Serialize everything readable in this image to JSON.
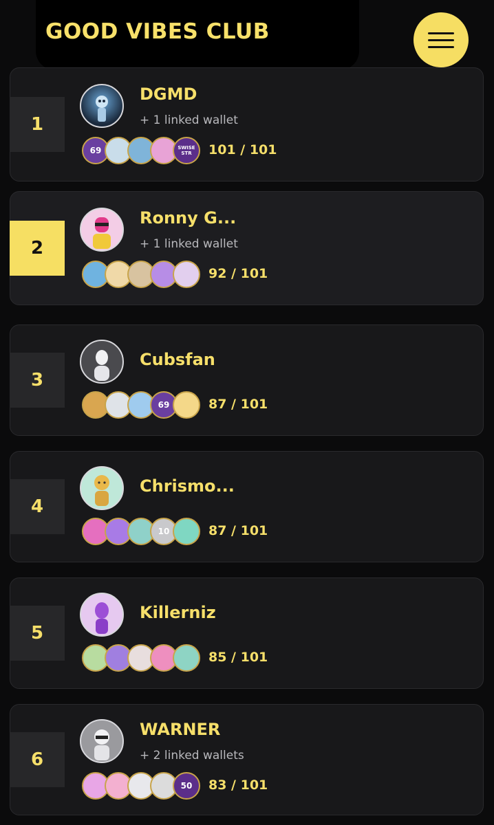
{
  "header": {
    "title": "GOOD VIBES CLUB",
    "menu_icon": "hamburger-menu-icon"
  },
  "colors": {
    "accent": "#f6df63",
    "card_bg": "#18181a",
    "rank_bg": "#272729",
    "page_bg": "#0b0b0c"
  },
  "leaderboard": [
    {
      "rank": "1",
      "name": "DGMD",
      "linked": "+ 1 linked wallet",
      "score": "101 / 101",
      "badges": [
        {
          "label": "69",
          "color": "#6a3fa0"
        },
        {
          "label": "",
          "color": "#c9ddea"
        },
        {
          "label": "",
          "color": "#7fb4d9"
        },
        {
          "label": "",
          "color": "#e8a3d6"
        },
        {
          "label": "SWISE STR",
          "color": "#5b2e8a"
        }
      ]
    },
    {
      "rank": "2",
      "name": "Ronny G...",
      "linked": "+ 1 linked wallet",
      "score": "92 / 101",
      "badges": [
        {
          "label": "",
          "color": "#6fb3e0"
        },
        {
          "label": "",
          "color": "#f0d9a8"
        },
        {
          "label": "",
          "color": "#d8c3a0"
        },
        {
          "label": "",
          "color": "#b78de6"
        },
        {
          "label": "",
          "color": "#e2cfee"
        }
      ]
    },
    {
      "rank": "3",
      "name": "Cubsfan",
      "linked": "",
      "score": "87 / 101",
      "badges": [
        {
          "label": "",
          "color": "#d9a650"
        },
        {
          "label": "",
          "color": "#dfe3e8"
        },
        {
          "label": "",
          "color": "#9fcbee"
        },
        {
          "label": "69",
          "color": "#6a3fa0"
        },
        {
          "label": "",
          "color": "#f4d889"
        }
      ]
    },
    {
      "rank": "4",
      "name": "Chrismo...",
      "linked": "",
      "score": "87 / 101",
      "badges": [
        {
          "label": "",
          "color": "#e56fbf"
        },
        {
          "label": "",
          "color": "#a87be6"
        },
        {
          "label": "",
          "color": "#8fd1c9"
        },
        {
          "label": "10",
          "color": "#c9c9cc"
        },
        {
          "label": "",
          "color": "#7fd7c2"
        }
      ]
    },
    {
      "rank": "5",
      "name": "Killerniz",
      "linked": "",
      "score": "85 / 101",
      "badges": [
        {
          "label": "",
          "color": "#b8dca0"
        },
        {
          "label": "",
          "color": "#a07fe0"
        },
        {
          "label": "",
          "color": "#e8dede"
        },
        {
          "label": "",
          "color": "#ee8fbf"
        },
        {
          "label": "",
          "color": "#8ed4c4"
        }
      ]
    },
    {
      "rank": "6",
      "name": "WARNER",
      "linked": "+ 2 linked wallets",
      "score": "83 / 101",
      "badges": [
        {
          "label": "",
          "color": "#e8a6e6"
        },
        {
          "label": "",
          "color": "#f3b0d0"
        },
        {
          "label": "",
          "color": "#e8e8ec"
        },
        {
          "label": "",
          "color": "#dcdcdc"
        },
        {
          "label": "50",
          "color": "#5b2e8a"
        }
      ]
    }
  ]
}
